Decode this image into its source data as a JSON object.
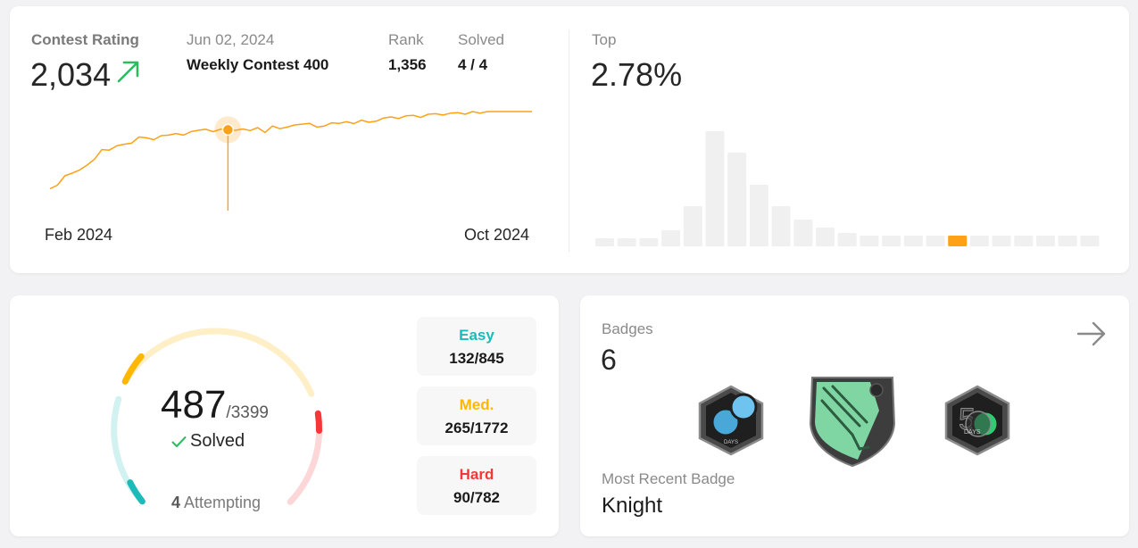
{
  "rating": {
    "label": "Contest Rating",
    "value": "2,034",
    "trend_icon": "arrow-up-right-icon",
    "trend_color": "#2cbb5d",
    "contest_date": "Jun 02, 2024",
    "contest_name": "Weekly Contest 400",
    "rank_label": "Rank",
    "rank_value": "1,356",
    "solved_label": "Solved",
    "solved_value": "4 / 4",
    "axis_start": "Feb 2024",
    "axis_end": "Oct 2024",
    "line_color": "#ffa116",
    "history_estimate": [
      1712,
      1725,
      1760,
      1770,
      1782,
      1800,
      1822,
      1858,
      1856,
      1872,
      1878,
      1882,
      1905,
      1902,
      1895,
      1910,
      1912,
      1918,
      1912,
      1925,
      1930,
      1934,
      1925,
      1934,
      1932,
      1930,
      1935,
      1929,
      1940,
      1922,
      1946,
      1936,
      1942,
      1950,
      1953,
      1956,
      1942,
      1946,
      1958,
      1956,
      1962,
      1955,
      1968,
      1960,
      1964,
      1976,
      1980,
      1974,
      1984,
      1986,
      1978,
      1990,
      1992,
      1987,
      1994,
      1996,
      1990,
      2000,
      1994,
      2012,
      2004,
      2016,
      2008,
      2024,
      2034,
      2030
    ]
  },
  "top": {
    "label": "Top",
    "value": "2.78%",
    "distribution_estimate": [
      3,
      3,
      3,
      6,
      15,
      43,
      35,
      23,
      15,
      10,
      7,
      5,
      4,
      4,
      4,
      4,
      4,
      4,
      4,
      4,
      4,
      4,
      4
    ],
    "highlight_index": 16,
    "highlight_color": "#ffa116",
    "bar_color": "#f0f0f0"
  },
  "solved": {
    "count": "487",
    "total": "/3399",
    "solved_label": "Solved",
    "check_icon": "check-icon",
    "attempting_count": "4",
    "attempting_label": " Attempting",
    "easy": {
      "label": "Easy",
      "value": "132/845",
      "color": "#1cbaba"
    },
    "medium": {
      "label": "Med.",
      "value": "265/1772",
      "color": "#ffb700"
    },
    "hard": {
      "label": "Hard",
      "value": "90/782",
      "color": "#f63737"
    }
  },
  "badges": {
    "label": "Badges",
    "count": "6",
    "arrow_icon": "arrow-right-icon",
    "recent_label": "Most Recent Badge",
    "recent_name": "Knight",
    "badge_icons": [
      "days-badge-icon",
      "knight-badge-icon",
      "50-days-badge-icon"
    ]
  }
}
